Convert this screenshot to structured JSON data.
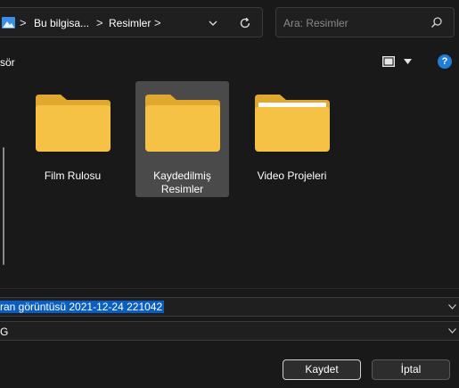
{
  "address": {
    "crumbs": [
      "Bu bilgisa...",
      "Resimler"
    ],
    "separator": ">"
  },
  "search": {
    "placeholder": "Ara: Resimler"
  },
  "toolbar": {
    "left_text": "sör",
    "help_glyph": "?"
  },
  "folders": [
    {
      "label_line1": "Film Rulosu",
      "label_line2": "",
      "selected": false
    },
    {
      "label_line1": "Kaydedilmiş",
      "label_line2": "Resimler",
      "selected": true
    },
    {
      "label_line1": "Video Projeleri",
      "label_line2": "",
      "selected": false
    }
  ],
  "filename": {
    "value": "ran görüntüsü 2021-12-24 221042"
  },
  "filetype": {
    "value": "G"
  },
  "buttons": {
    "save": "Kaydet",
    "cancel": "İptal"
  },
  "colors": {
    "accent": "#0a5ec2",
    "folder": "#f6c245",
    "help": "#1f7fd6"
  }
}
